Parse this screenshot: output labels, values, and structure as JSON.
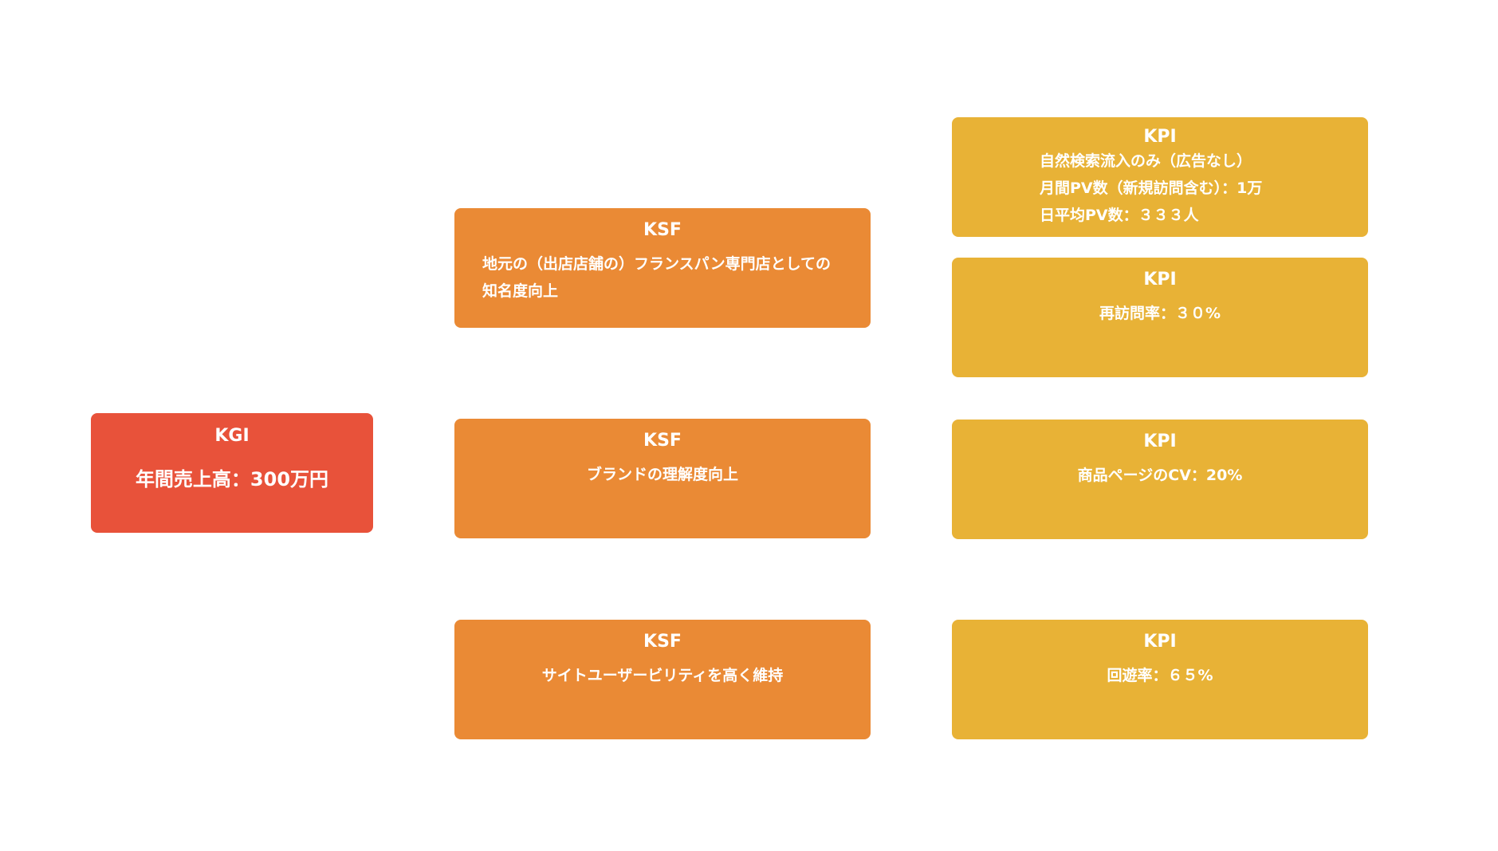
{
  "kgi": {
    "title": "KGI",
    "lines": [
      "年間売上高：300万円"
    ]
  },
  "ksf": [
    {
      "title": "KSF",
      "lines": [
        "地元の（出店店舗の）フランスパン専門店としての",
        "知名度向上"
      ]
    },
    {
      "title": "KSF",
      "lines": [
        "ブランドの理解度向上"
      ]
    },
    {
      "title": "KSF",
      "lines": [
        "サイトユーザービリティを高く維持"
      ]
    }
  ],
  "kpi": [
    {
      "title": "KPI",
      "lines": [
        "自然検索流入のみ（広告なし）",
        "月間PV数（新規訪問含む）：1万",
        "日平均PV数：３３３人"
      ]
    },
    {
      "title": "KPI",
      "lines": [
        "再訪問率：３０%"
      ]
    },
    {
      "title": "KPI",
      "lines": [
        "商品ページのCV：20%"
      ]
    },
    {
      "title": "KPI",
      "lines": [
        "回遊率：６５%"
      ]
    }
  ],
  "colors": {
    "kgi": "#e8523a",
    "ksf": "#ea8a35",
    "kpi": "#e8b236",
    "text": "#ffffff"
  }
}
